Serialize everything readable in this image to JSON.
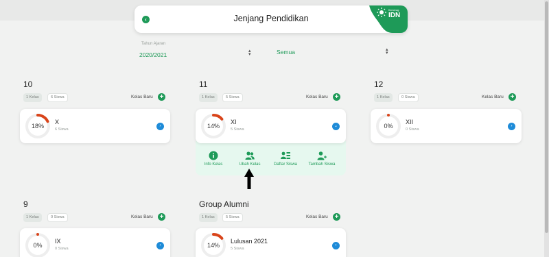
{
  "header": {
    "title": "Jenjang Pendidikan",
    "logo_top": "Kemenag",
    "logo_main": "IDN"
  },
  "filters": {
    "year_label": "Tahun Ajaran",
    "year_value": "2020/2021",
    "scope_value": "Semua"
  },
  "colors": {
    "accent": "#1e9a58",
    "chevron": "#1e8bd8",
    "progress": "#d9441a",
    "expand_bg": "#e6f8ef"
  },
  "groups": [
    {
      "title": "10",
      "kelas": "1 Kelas",
      "siswa": "6 Siswa",
      "new_label": "Kelas Baru",
      "card": {
        "percent_label": "18%",
        "progress": 0.18,
        "name": "X",
        "students": "6 Siswa",
        "chevron": "›"
      }
    },
    {
      "title": "11",
      "kelas": "1 Kelas",
      "siswa": "5 Siswa",
      "new_label": "Kelas Baru",
      "card": {
        "percent_label": "14%",
        "progress": 0.14,
        "name": "XI",
        "students": "5 Siswa",
        "chevron": "⌄"
      }
    },
    {
      "title": "12",
      "kelas": "1 Kelas",
      "siswa": "0 Siswa",
      "new_label": "Kelas Baru",
      "card": {
        "percent_label": "0%",
        "progress": 0,
        "name": "XII",
        "students": "0 Siswa",
        "chevron": "›"
      }
    },
    {
      "title": "9",
      "kelas": "1 Kelas",
      "siswa": "0 Siswa",
      "new_label": "Kelas Baru",
      "card": {
        "percent_label": "0%",
        "progress": 0,
        "name": "IX",
        "students": "0 Siswa",
        "chevron": "›"
      }
    },
    {
      "title": "Group Alumni",
      "kelas": "1 Kelas",
      "siswa": "5 Siswa",
      "new_label": "Kelas Baru",
      "card": {
        "percent_label": "14%",
        "progress": 0.14,
        "name": "Lulusan 2021",
        "students": "5 Siswa",
        "chevron": "›"
      }
    }
  ],
  "actions": [
    {
      "label": "Info Kelas",
      "icon": "info-icon"
    },
    {
      "label": "Ubah Kelas",
      "icon": "users-icon"
    },
    {
      "label": "Daftar Siswa",
      "icon": "student-list-icon"
    },
    {
      "label": "Tambah Siswa",
      "icon": "add-user-icon"
    }
  ]
}
